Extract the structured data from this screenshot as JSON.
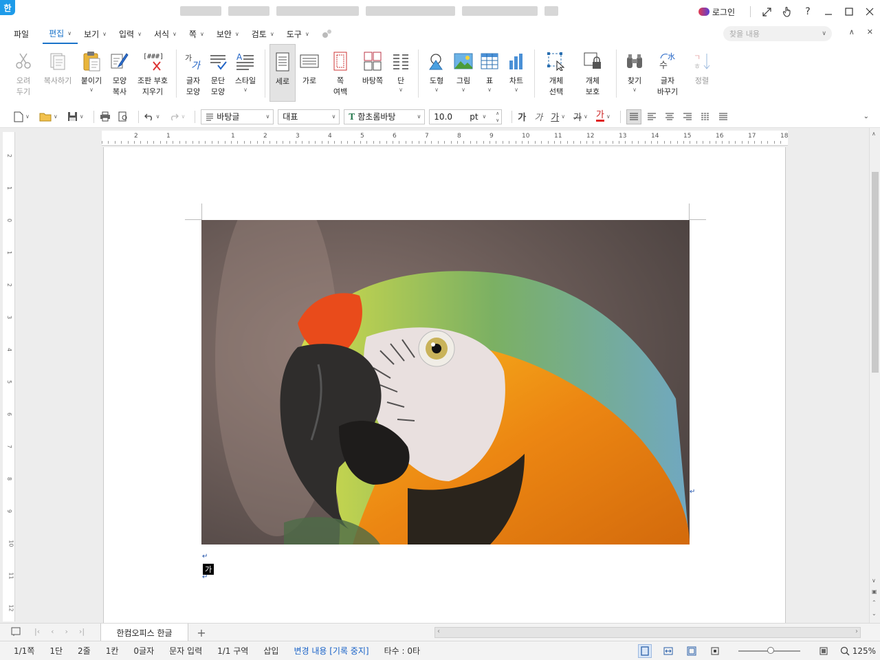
{
  "title": {
    "app_icon": "한",
    "login_label": "로그인"
  },
  "menu": {
    "file": "파일",
    "items": [
      "편집",
      "보기",
      "입력",
      "서식",
      "쪽",
      "보안",
      "검토",
      "도구"
    ],
    "active": "편집",
    "find_placeholder": "찾을 내용"
  },
  "ribbon": {
    "cut": [
      "오려",
      "두기"
    ],
    "copy": "복사하기",
    "paste": "붙이기",
    "format_copy": [
      "모양",
      "복사"
    ],
    "clear_markup": [
      "조판 부호",
      "지우기"
    ],
    "char_shape": [
      "글자",
      "모양"
    ],
    "para_shape": [
      "문단",
      "모양"
    ],
    "style": "스타일",
    "portrait": "세로",
    "landscape": "가로",
    "page_margin": [
      "쪽",
      "여백"
    ],
    "page_bg": "바탕쪽",
    "columns": "단",
    "shape": "도형",
    "picture": "그림",
    "table": "표",
    "chart": "차트",
    "object_select": [
      "개체",
      "선택"
    ],
    "object_protect": [
      "개체",
      "보호"
    ],
    "find": "찾기",
    "replace": [
      "글자",
      "바꾸기"
    ],
    "sort": "정렬",
    "clear_icon_text": "[###]"
  },
  "format": {
    "style": "바탕글",
    "lang": "대표",
    "font": "함초롬바탕",
    "size": "10.0",
    "unit": "pt",
    "char_gly": "가"
  },
  "ruler": {
    "h_numbers": [
      "2",
      "1",
      "1",
      "2",
      "3",
      "4",
      "5",
      "6",
      "7",
      "8",
      "9",
      "10",
      "11",
      "12",
      "13",
      "14",
      "15",
      "16",
      "17",
      "18"
    ],
    "v_numbers": [
      "2",
      "1",
      "0",
      "1",
      "2",
      "3",
      "4",
      "5",
      "6",
      "7",
      "8",
      "9",
      "10",
      "11",
      "12"
    ]
  },
  "document": {
    "para_mark": "↵",
    "cursor_char": "가"
  },
  "tabs": {
    "doc_tab": "한컴오피스 한글",
    "add": "+"
  },
  "status": {
    "page": "1/1쪽",
    "column": "1단",
    "line": "2줄",
    "col": "1칸",
    "chars": "0글자",
    "mode": "문자 입력",
    "section": "1/1 구역",
    "insert": "삽입",
    "track": "변경 내용 [기록 중지]",
    "keystrokes": "타수 : 0타",
    "zoom": "125%"
  },
  "colors": {
    "accent": "#1a73c9",
    "app_icon": "#1e9be9"
  }
}
